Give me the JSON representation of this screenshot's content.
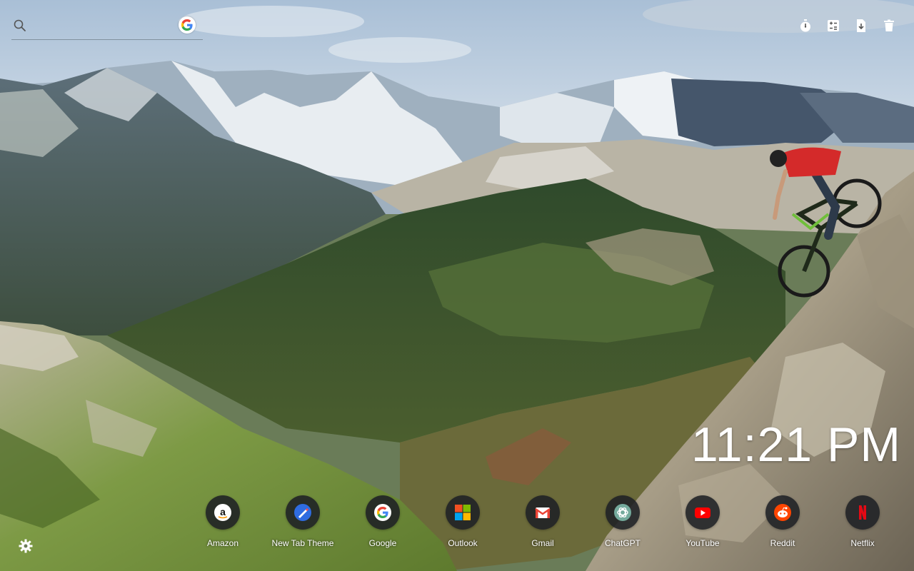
{
  "search": {
    "placeholder": "",
    "engine_icon": "google-logo-icon",
    "search_icon": "magnifier-icon"
  },
  "tools": [
    {
      "name": "timer-icon"
    },
    {
      "name": "calculator-icon"
    },
    {
      "name": "file-download-icon"
    },
    {
      "name": "trash-icon"
    }
  ],
  "clock": {
    "time": "11:21 PM"
  },
  "shortcuts": [
    {
      "label": "Amazon",
      "icon": "amazon-icon"
    },
    {
      "label": "New Tab Theme",
      "icon": "new-tab-theme-icon"
    },
    {
      "label": "Google",
      "icon": "google-icon"
    },
    {
      "label": "Outlook",
      "icon": "outlook-icon"
    },
    {
      "label": "Gmail",
      "icon": "gmail-icon"
    },
    {
      "label": "ChatGPT",
      "icon": "chatgpt-icon"
    },
    {
      "label": "YouTube",
      "icon": "youtube-icon"
    },
    {
      "label": "Reddit",
      "icon": "reddit-icon"
    },
    {
      "label": "Netflix",
      "icon": "netflix-icon"
    }
  ],
  "settings": {
    "icon": "gear-icon"
  },
  "colors": {
    "shortcut_bg": "#1e2024",
    "clock_text": "#ffffff",
    "sky_top": "#a9bfd6",
    "bike_jersey": "#d42a2a"
  }
}
